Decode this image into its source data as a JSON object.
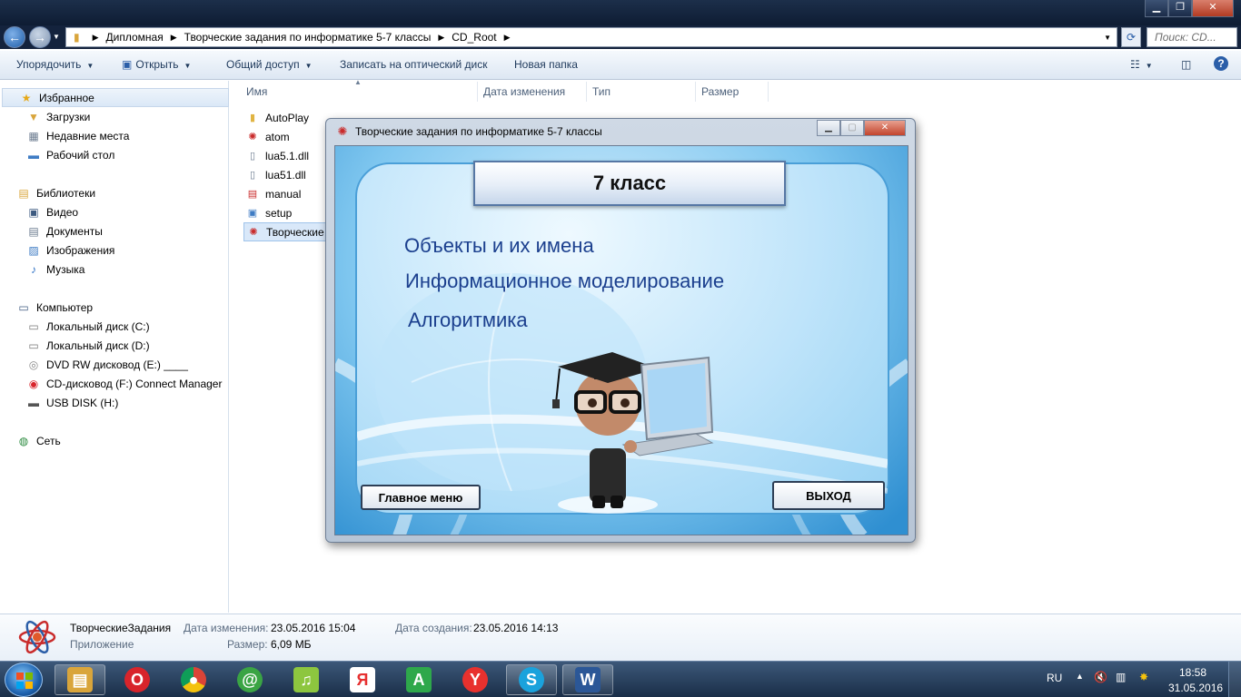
{
  "explorer": {
    "breadcrumb": [
      "Дипломная",
      "Творческие задания по информатике 5-7 классы",
      "CD_Root"
    ],
    "search_placeholder": "Поиск: CD...",
    "toolbar": {
      "organize": "Упорядочить",
      "open": "Открыть",
      "share": "Общий доступ",
      "burn": "Записать на оптический диск",
      "new_folder": "Новая папка"
    },
    "nav": {
      "favorites": "Избранное",
      "downloads": "Загрузки",
      "recent": "Недавние места",
      "desktop": "Рабочий стол",
      "libraries": "Библиотеки",
      "video": "Видео",
      "documents": "Документы",
      "pictures": "Изображения",
      "music": "Музыка",
      "computer": "Компьютер",
      "drive_c": "Локальный диск (C:)",
      "drive_d": "Локальный диск (D:)",
      "drive_e": "DVD RW дисковод (E:) ____",
      "drive_f": "CD-дисковод (F:) Connect Manager",
      "drive_h": "USB DISK (H:)",
      "network": "Сеть"
    },
    "columns": {
      "name": "Имя",
      "date": "Дата изменения",
      "type": "Тип",
      "size": "Размер"
    },
    "files": [
      {
        "name": "AutoPlay",
        "icon": "folder-icon"
      },
      {
        "name": "atom",
        "icon": "atom-icon"
      },
      {
        "name": "lua5.1.dll",
        "icon": "dll-icon"
      },
      {
        "name": "lua51.dll",
        "icon": "dll-icon"
      },
      {
        "name": "manual",
        "icon": "pdf-icon"
      },
      {
        "name": "setup",
        "icon": "setup-icon"
      },
      {
        "name": "Творческие",
        "icon": "app-icon"
      }
    ],
    "details": {
      "filename": "ТворческиеЗадания",
      "filetype": "Приложение",
      "modified_label": "Дата изменения:",
      "modified_value": "23.05.2016 15:04",
      "created_label": "Дата создания:",
      "created_value": "23.05.2016 14:13",
      "size_label": "Размер:",
      "size_value": "6,09 МБ"
    }
  },
  "dialog": {
    "title": "Творческие задания по информатике 5-7 классы",
    "header": "7 класс",
    "topics": [
      "Объекты и их имена",
      "Информационное моделирование",
      "Алгоритмика"
    ],
    "main_menu_button": "Главное меню",
    "exit_button": "ВЫХОД"
  },
  "taskbar": {
    "apps": [
      {
        "name": "explorer",
        "glyph": "▤",
        "color": "#d9a53b"
      },
      {
        "name": "opera",
        "glyph": "O",
        "color": "#d8242b"
      },
      {
        "name": "chrome",
        "glyph": "◉",
        "color": "#3a9b45"
      },
      {
        "name": "mail",
        "glyph": "@",
        "color": "#3aa444"
      },
      {
        "name": "music",
        "glyph": "♫",
        "color": "#8dc63f"
      },
      {
        "name": "yandex",
        "glyph": "Я",
        "color": "#e63030"
      },
      {
        "name": "app-a",
        "glyph": "A",
        "color": "#2ea84b"
      },
      {
        "name": "yandex-browser",
        "glyph": "Y",
        "color": "#e8312e"
      },
      {
        "name": "skype",
        "glyph": "S",
        "color": "#1aa2dc"
      },
      {
        "name": "word",
        "glyph": "W",
        "color": "#2b5797"
      }
    ],
    "lang": "RU",
    "time": "18:58",
    "date": "31.05.2016"
  },
  "colors": {
    "accent": "#1b3f8e",
    "dialog_bg": "#7ec6ef",
    "taskbar": "#1a2e48"
  }
}
